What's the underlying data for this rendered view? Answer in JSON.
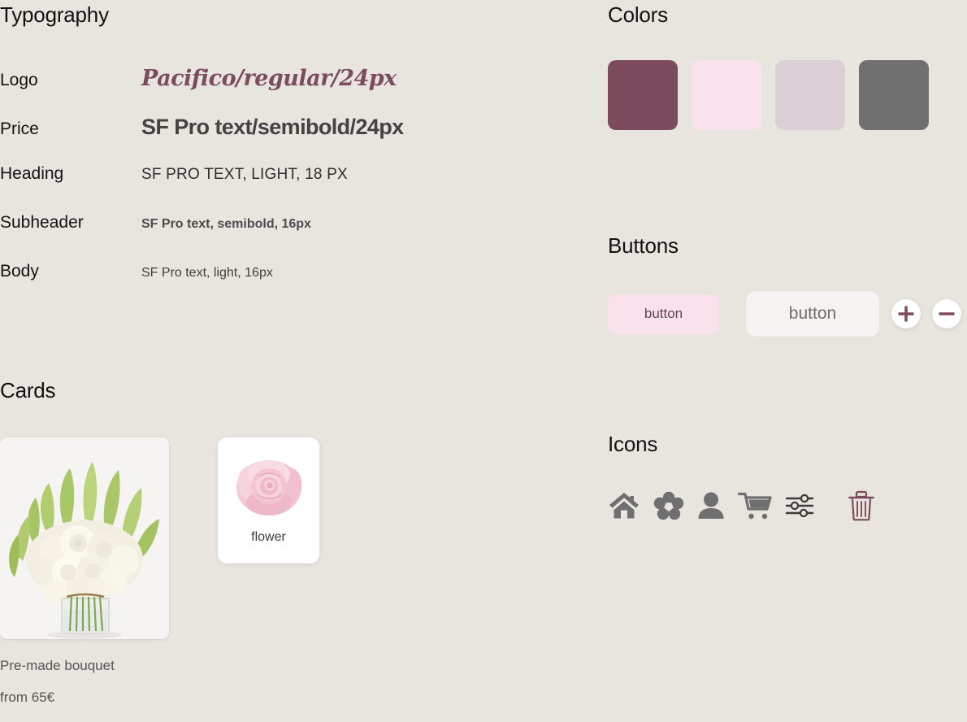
{
  "sections": {
    "typography": "Typography",
    "cards": "Cards",
    "colors": "Colors",
    "buttons": "Buttons",
    "icons": "Icons"
  },
  "typography": {
    "rows": [
      {
        "label": "Logo",
        "sample": "Pacifico/regular/24px"
      },
      {
        "label": "Price",
        "sample": "SF Pro text/semibold/24px"
      },
      {
        "label": "Heading",
        "sample": "SF PRO TEXT, LIGHT, 18 PX"
      },
      {
        "label": "Subheader",
        "sample": "SF Pro text, semibold, 16px"
      },
      {
        "label": "Body",
        "sample": "SF Pro text, light, 16px"
      }
    ]
  },
  "colors": {
    "swatches": [
      {
        "name": "maroon",
        "hex": "#7c4c5e"
      },
      {
        "name": "pale-pink",
        "hex": "#fae2ec"
      },
      {
        "name": "mauve",
        "hex": "#dcd0d6"
      },
      {
        "name": "gray",
        "hex": "#706f6f"
      }
    ]
  },
  "buttons": {
    "primary_label": "button",
    "secondary_label": "button",
    "plus_icon": "plus-icon",
    "minus_icon": "minus-icon",
    "icon_color": "#7c4c5e"
  },
  "icons": {
    "color": "#706f6f",
    "trash_color": "#7c4c5e",
    "items": [
      "home-icon",
      "flower-icon",
      "person-icon",
      "shopping-cart-icon",
      "sliders-icon",
      "trash-icon"
    ]
  },
  "cards": {
    "large": {
      "image_alt": "white-bouquet-in-vase",
      "title": "Pre-made bouquet",
      "price": "from 65€"
    },
    "small": {
      "image_alt": "pink-rose",
      "label": "flower"
    }
  }
}
